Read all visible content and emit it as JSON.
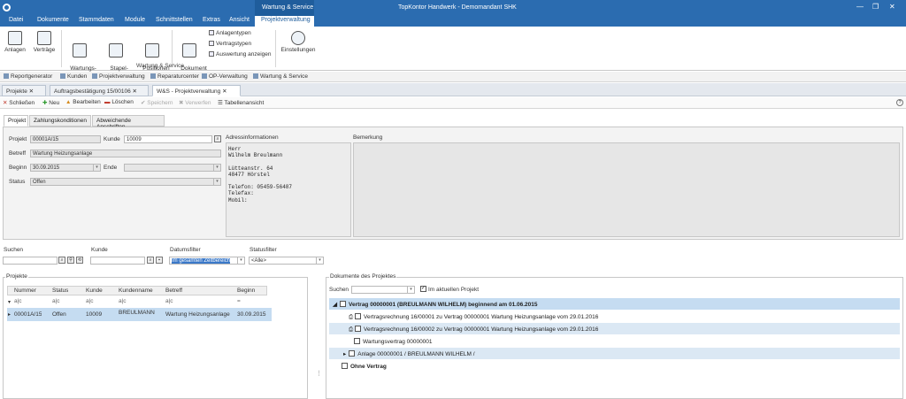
{
  "window": {
    "title": "TopKontor Handwerk - Demomandant SHK",
    "context_group": "Wartung & Service",
    "controls": [
      "—",
      "❐",
      "✕"
    ]
  },
  "menu": [
    "Datei",
    "Dokumente",
    "Stammdaten",
    "Module",
    "Schnittstellen",
    "Extras",
    "Ansicht",
    "Projektverwaltung"
  ],
  "ribbon": {
    "buttons": [
      {
        "label": "Anlagen"
      },
      {
        "label": "Verträge"
      },
      {
        "label": "Wartungs-\naufgaben"
      },
      {
        "label": "Stapel-\nverarbeitung"
      },
      {
        "label": "Positionen\npflegen"
      },
      {
        "label": "Dokument\n▾"
      },
      {
        "label": "Einstellungen"
      }
    ],
    "small": [
      "Anlagentypen",
      "Vertragstypen",
      "Auswertung anzeigen"
    ],
    "group_label": "Wartung & Service"
  },
  "quickbar": [
    "Reportgenerator",
    "Kunden",
    "Projektverwaltung",
    "Reparaturcenter",
    "OP-Verwaltung",
    "Wartung & Service"
  ],
  "doc_tabs": [
    "Projekte",
    "Auftragsbestätigung 15/00106",
    "W&S - Projektverwaltung"
  ],
  "toolbar": [
    "Schließen",
    "Neu",
    "Bearbeiten",
    "Löschen",
    "Speichern",
    "Verwerfen",
    "Tabellenansicht"
  ],
  "help": "?",
  "inner_tabs": [
    "Projekt",
    "Zahlungskonditionen",
    "Abweichende Anschriften"
  ],
  "form": {
    "projekt_label": "Projekt",
    "projekt_value": "00001A/15",
    "kunde_label": "Kunde",
    "kunde_value": "10009",
    "betreff_label": "Betreff",
    "betreff_value": "Wartung Heizungsanlage",
    "beginn_label": "Beginn",
    "beginn_value": "30.09.2015",
    "ende_label": "Ende",
    "ende_value": "",
    "status_label": "Status",
    "status_value": "Offen"
  },
  "address": {
    "title": "Adressinformationen",
    "lines": "Herr\nWilhelm Breulmann\n\nLütteanstr. 64\n48477 Hörstel\n\nTelefon: 05459-56487\nTelefax:\nMobil:"
  },
  "remark": {
    "title": "Bemerkung"
  },
  "filters": {
    "suchen_label": "Suchen",
    "kunde_label": "Kunde",
    "datum_label": "Datumsfilter",
    "status_label": "Statusfilter",
    "datum_value": "Im gesamten Zeitbereich",
    "status_value": "<Alle>"
  },
  "projects": {
    "title": "Projekte",
    "columns": [
      "Nummer",
      "Status",
      "Kunde",
      "Kundenname",
      "Betreff",
      "Beginn"
    ],
    "filter_row": [
      "a|c",
      "a|c",
      "a|c",
      "a|c",
      "a|c",
      "="
    ],
    "rows": [
      [
        "00001A/15",
        "Offen",
        "10009",
        "BREULMANN",
        "Wartung Heizungsanlage",
        "30.09.2015"
      ]
    ]
  },
  "documents": {
    "title": "Dokumente des Projektes",
    "suchen_label": "Suchen",
    "checkbox_label": "Im aktuellen Projekt",
    "tree": [
      {
        "text": "Vertrag 00000001 (BREULMANN WILHELM) beginnend am 01.06.2015",
        "bold": true
      },
      {
        "text": "Vertragsrechnung 16/00001 zu Vertrag 00000001 Wartung Heizungsanlage vom 29.01.2016"
      },
      {
        "text": "Vertragsrechnung 16/00002 zu Vertrag 00000001 Wartung Heizungsanlage vom 29.01.2016"
      },
      {
        "text": "Wartungsvertrag 00000001"
      },
      {
        "text": "Anlage 00000001 / BREULMANN WILHELM /"
      },
      {
        "text": "Ohne Vertrag",
        "bold": true
      }
    ]
  }
}
